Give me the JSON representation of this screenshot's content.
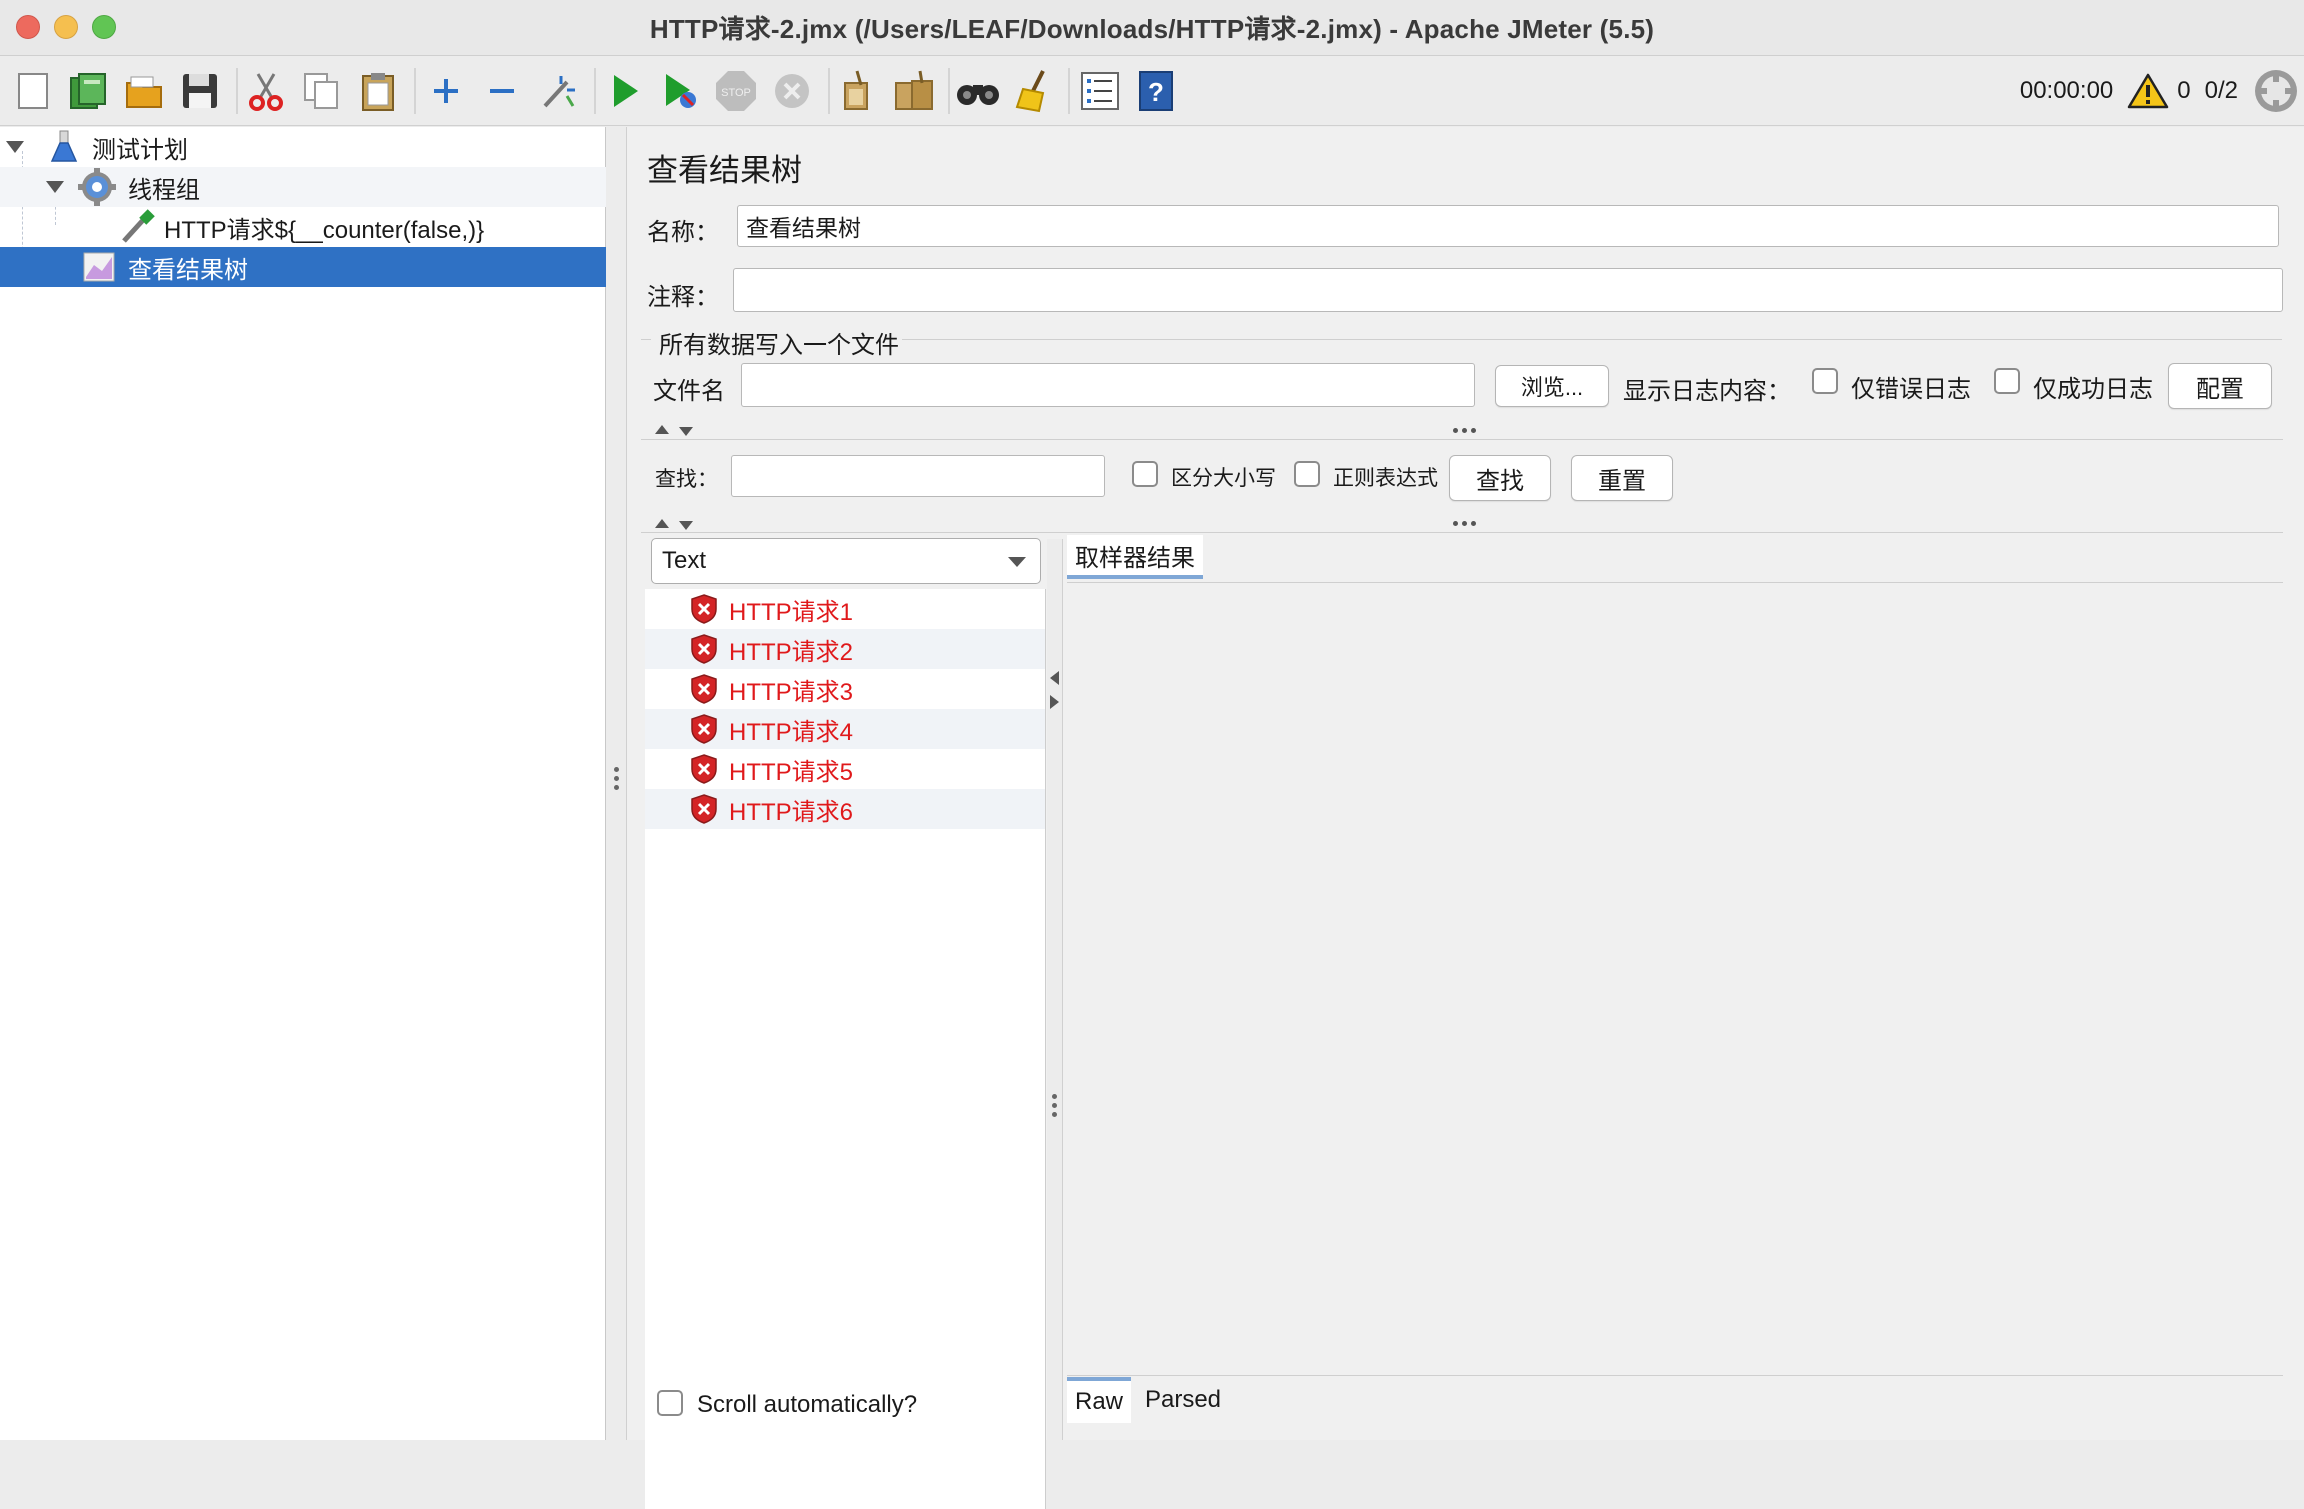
{
  "window": {
    "title": "HTTP请求-2.jmx (/Users/LEAF/Downloads/HTTP请求-2.jmx) - Apache JMeter (5.5)"
  },
  "toolbar": {
    "icons": [
      "new-icon",
      "templates-icon",
      "open-icon",
      "save-icon",
      "cut-icon",
      "copy-icon",
      "paste-icon",
      "expand-icon",
      "collapse-icon",
      "toggle-icon",
      "start-icon",
      "start-no-pause-icon",
      "stop-icon",
      "shutdown-icon",
      "clear-icon",
      "clear-all-icon",
      "search-icon",
      "reset-search-icon",
      "function-helper-icon",
      "help-icon"
    ],
    "timer": "00:00:00",
    "warning_count": "0",
    "threads": "0/2"
  },
  "tree": {
    "items": [
      {
        "label": "测试计划",
        "icon": "test-plan-flask-icon"
      },
      {
        "label": "线程组",
        "icon": "thread-group-gear-icon"
      },
      {
        "label": "HTTP请求${__counter(false,)}",
        "icon": "http-sampler-pipette-icon"
      },
      {
        "label": "查看结果树",
        "icon": "result-tree-chart-icon"
      }
    ]
  },
  "panel": {
    "title": "查看结果树",
    "name_label": "名称：",
    "name_value": "查看结果树",
    "comment_label": "注释：",
    "comment_value": "",
    "file_section_title": "所有数据写入一个文件",
    "filename_label": "文件名",
    "filename_value": "",
    "browse_button": "浏览...",
    "log_content_label": "显示日志内容：",
    "errors_only_label": "仅错误日志",
    "success_only_label": "仅成功日志",
    "configure_button": "配置",
    "search_label": "查找：",
    "search_value": "",
    "case_sensitive_label": "区分大小写",
    "regex_label": "正则表达式",
    "find_button": "查找",
    "reset_button": "重置"
  },
  "results": {
    "renderer_selected": "Text",
    "items": [
      "HTTP请求1",
      "HTTP请求2",
      "HTTP请求3",
      "HTTP请求4",
      "HTTP请求5",
      "HTTP请求6"
    ],
    "error_color": "#e0191b",
    "scroll_auto_label": "Scroll automatically?",
    "tab_sampler_result": "取样器结果",
    "bottom_tabs": [
      "Raw",
      "Parsed"
    ]
  },
  "colors": {
    "selection": "#2f71c4",
    "tab_underline": "#7fa7d6"
  }
}
